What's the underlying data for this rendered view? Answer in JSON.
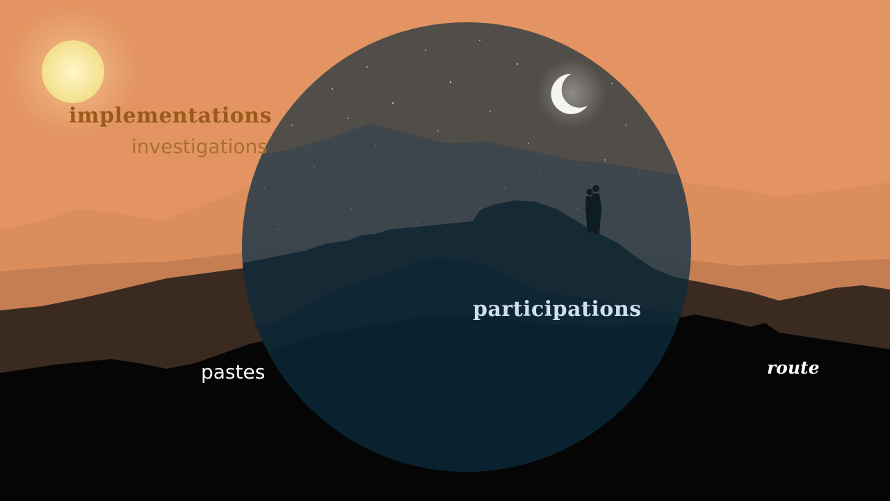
{
  "labels": {
    "implementations": "implementations",
    "investigations": "investigations",
    "participations": "participations",
    "pastes": "pastes",
    "route": "route"
  },
  "colors": {
    "sky": "#e39462",
    "sun": "#f6e8a0",
    "circle": "#0c2c3c",
    "moon": "#f4f4f0",
    "implementations_text": "#9a5a1a",
    "investigations_text": "#a8702c",
    "participations_text": "#cfe0f2",
    "pastes_text": "#ffffff",
    "route_text": "#ffffff"
  },
  "icons": [
    "sun-icon",
    "moon-icon",
    "couple-silhouette-icon"
  ]
}
